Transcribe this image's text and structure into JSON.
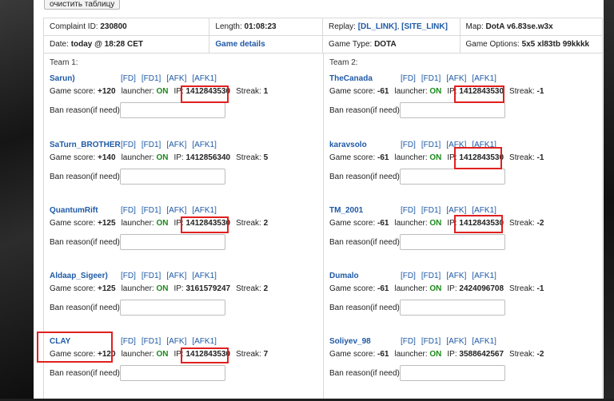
{
  "toolbar": {
    "clear_label": "очистить таблицу"
  },
  "info": {
    "complaint": "230800",
    "length": "01:08:23",
    "replay_links": [
      "[DL_LINK]",
      "[SITE_LINK]"
    ],
    "map": "DotA v6.83se.w3x",
    "date": "today @ 18:28 CET",
    "game_details": "Game details",
    "game_type": "DOTA",
    "game_options": "5x5 xl83tb 99kkkk"
  },
  "labels": {
    "complaint": "Complaint ID:",
    "length": "Length:",
    "replay": "Replay:",
    "map": "Map:",
    "date": "Date:",
    "game_type": "Game Type:",
    "game_options": "Game Options:",
    "game_score": "Game score:",
    "launcher": "launcher:",
    "ip": "IP:",
    "streak": "Streak:",
    "ban_reason": "Ban reason(if need):",
    "flags": [
      "[FD]",
      "[FD1]",
      "[AFK]",
      "[AFK1]"
    ]
  },
  "team1": {
    "label": "Team 1:",
    "players": [
      {
        "name": "Sarun)",
        "score": "+120",
        "launcher": "ON",
        "ip": "1412843530",
        "streak": "1"
      },
      {
        "name": "SaTurn_BROTHER",
        "score": "+140",
        "launcher": "ON",
        "ip": "1412856340",
        "streak": "5"
      },
      {
        "name": "QuantumRift",
        "score": "+125",
        "launcher": "ON",
        "ip": "1412843530",
        "streak": "2"
      },
      {
        "name": "Aldaap_Sigeer)",
        "score": "+125",
        "launcher": "ON",
        "ip": "3161579247",
        "streak": "2"
      },
      {
        "name": "CLAY",
        "score": "+120",
        "launcher": "ON",
        "ip": "1412843530",
        "streak": "7"
      }
    ]
  },
  "team2": {
    "label": "Team 2:",
    "players": [
      {
        "name": "TheCanada",
        "score": "-61",
        "launcher": "ON",
        "ip": "1412843530",
        "streak": "-1"
      },
      {
        "name": "karavsolo",
        "score": "-61",
        "launcher": "ON",
        "ip": "1412843530",
        "streak": "-1"
      },
      {
        "name": "TM_2001",
        "score": "-61",
        "launcher": "ON",
        "ip": "1412843530",
        "streak": "-2"
      },
      {
        "name": "Dumalo",
        "score": "-61",
        "launcher": "ON",
        "ip": "2424096708",
        "streak": "-1"
      },
      {
        "name": "Soliyev_98",
        "score": "-61",
        "launcher": "ON",
        "ip": "3588642567",
        "streak": "-2"
      }
    ]
  },
  "colors": {
    "highlight": "#e02020",
    "link": "#1f5aa6",
    "launcher_on": "#1a8a1a"
  }
}
